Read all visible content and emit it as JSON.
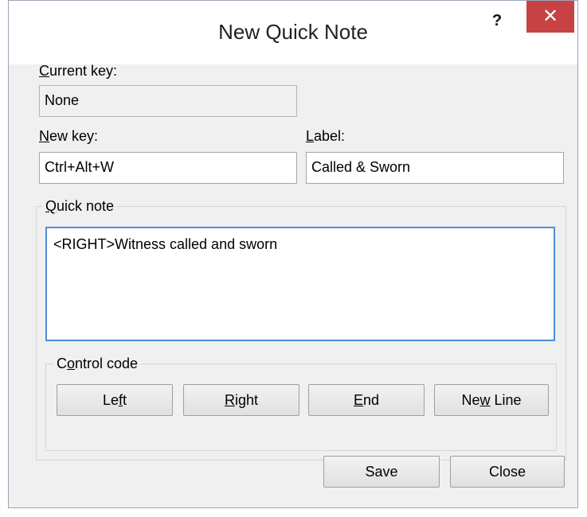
{
  "window": {
    "title": "New Quick Note",
    "help_icon_glyph": "?",
    "close_icon_glyph": "✕"
  },
  "current_key": {
    "label_accel": "C",
    "label_rest": "urrent key:",
    "value": "None"
  },
  "new_key": {
    "label_accel": "N",
    "label_rest": "ew key:",
    "value": "Ctrl+Alt+W"
  },
  "label_field": {
    "label_accel": "L",
    "label_rest": "abel:",
    "value": "Called & Sworn"
  },
  "quick_note": {
    "group_label_accel": "Q",
    "group_label_rest": "uick note",
    "text": "<RIGHT>Witness called and sworn"
  },
  "control_code": {
    "group_label_pre": "C",
    "group_label_accel": "o",
    "group_label_rest": "ntrol code",
    "buttons": [
      {
        "pre": "Le",
        "accel": "f",
        "post": "t"
      },
      {
        "pre": "",
        "accel": "R",
        "post": "ight"
      },
      {
        "pre": "",
        "accel": "E",
        "post": "nd"
      },
      {
        "pre": "Ne",
        "accel": "w",
        "post": " Line"
      }
    ]
  },
  "footer": {
    "save_label": "Save",
    "close_label": "Close"
  }
}
